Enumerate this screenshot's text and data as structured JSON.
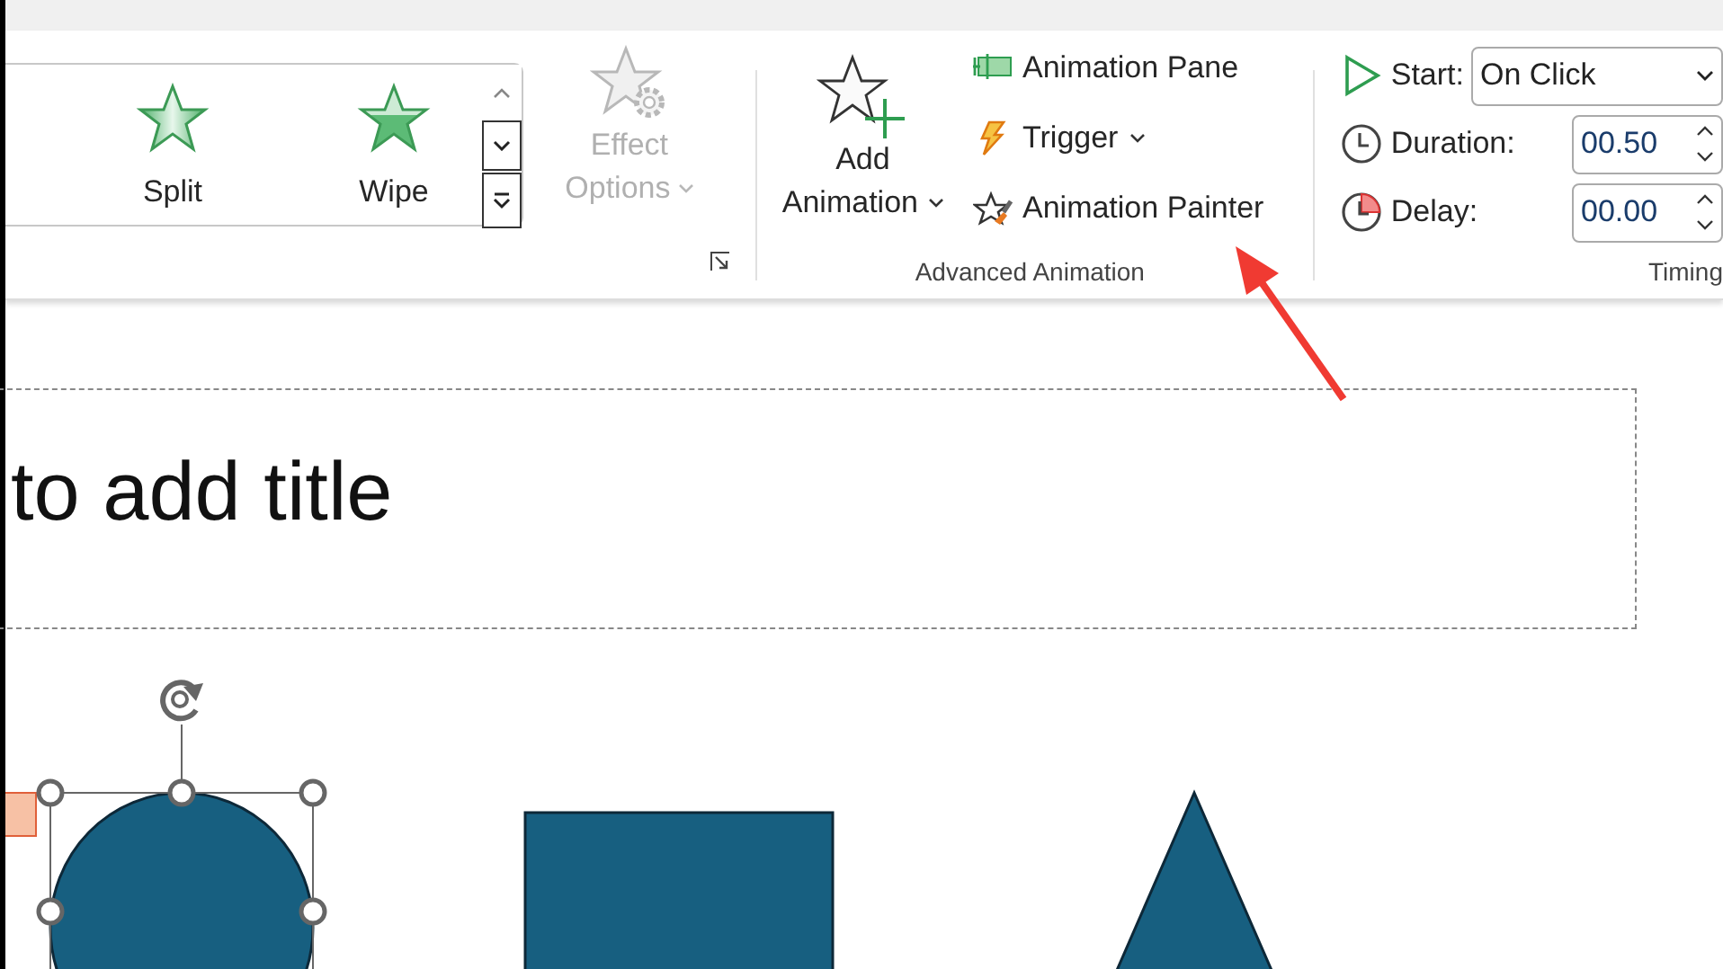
{
  "gallery": {
    "effects": [
      {
        "label": "Split",
        "kind": "split"
      },
      {
        "label": "Wipe",
        "kind": "wipe"
      }
    ]
  },
  "effect_options": {
    "label_lines": [
      "Effect",
      "Options"
    ],
    "disabled": true
  },
  "advanced_animation": {
    "add_animation": [
      "Add",
      "Animation"
    ],
    "items": [
      {
        "label": "Animation Pane",
        "kind": "pane",
        "dropdown": false
      },
      {
        "label": "Trigger",
        "kind": "trigger",
        "dropdown": true
      },
      {
        "label": "Animation Painter",
        "kind": "painter",
        "dropdown": false
      }
    ],
    "group_label": "Advanced Animation"
  },
  "timing": {
    "start": {
      "label": "Start:",
      "value": "On Click"
    },
    "duration": {
      "label": "Duration:",
      "value": "00.50"
    },
    "delay": {
      "label": "Delay:",
      "value": "00.00"
    },
    "group_label": "Timing"
  },
  "slide": {
    "title_placeholder": "to add title",
    "shapes": [
      {
        "kind": "ellipse",
        "selected": true
      },
      {
        "kind": "rectangle",
        "selected": false
      },
      {
        "kind": "triangle",
        "selected": false
      }
    ]
  }
}
